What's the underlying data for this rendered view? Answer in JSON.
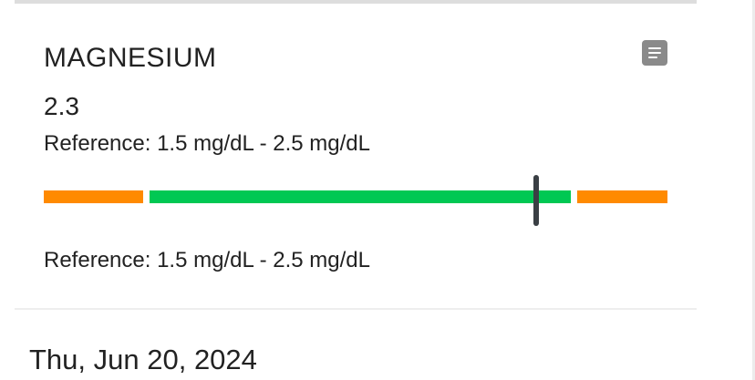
{
  "result": {
    "test_name": "MAGNESIUM",
    "value": "2.3",
    "reference_text": "Reference: 1.5 mg/dL - 2.5 mg/dL",
    "reference_text_repeat": "Reference: 1.5 mg/dL - 2.5 mg/dL",
    "notes_icon": "notes-icon",
    "range_indicator": {
      "numeric_value": 2.3,
      "segments": [
        {
          "name": "low",
          "color": "#ff8a00",
          "from": 0.0,
          "to": 0.16
        },
        {
          "name": "normal",
          "color": "#00c853",
          "from": 0.17,
          "to": 0.845
        },
        {
          "name": "high",
          "color": "#ff8a00",
          "from": 0.855,
          "to": 1.0
        }
      ],
      "marker_position_fraction": 0.79,
      "marker_color": "#3a3f44"
    }
  },
  "next_section": {
    "date": "Thu, Jun 20, 2024"
  }
}
